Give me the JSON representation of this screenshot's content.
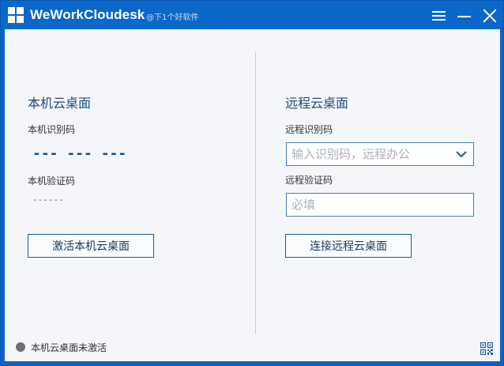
{
  "titlebar": {
    "app_title": "WeWorkCloudesk",
    "watermark": "@下1个好软件",
    "icons": [
      "menu-icon",
      "minimize-icon",
      "close-icon"
    ]
  },
  "local": {
    "title": "本机云桌面",
    "id_label": "本机识别码",
    "id_value": "--- --- ---",
    "verify_label": "本机验证码",
    "verify_value": "------",
    "activate_button": "激活本机云桌面"
  },
  "remote": {
    "title": "远程云桌面",
    "id_label": "远程识别码",
    "id_placeholder": "输入识别码，远程办公",
    "id_value": "",
    "verify_label": "远程验证码",
    "verify_placeholder": "必填",
    "verify_value": "",
    "connect_button": "连接远程云桌面"
  },
  "status": {
    "text": "本机云桌面未激活",
    "dot_color": "#707070"
  },
  "colors": {
    "titlebar": "#0b67c9",
    "accent": "#1f5a93",
    "background": "#f4f6fa"
  }
}
